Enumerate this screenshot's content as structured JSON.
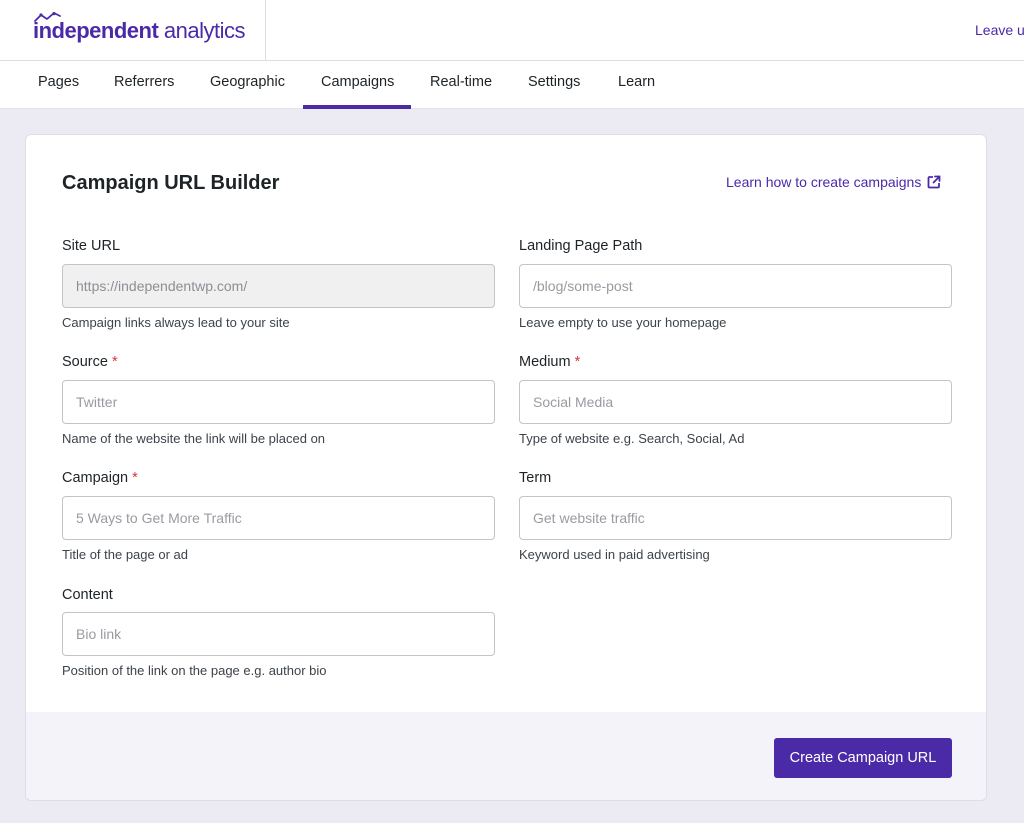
{
  "brand": {
    "bold": "independent",
    "light": " analytics",
    "color": "#4b2aa8"
  },
  "header": {
    "leave_link": "Leave u"
  },
  "nav": {
    "items": [
      {
        "label": "Pages"
      },
      {
        "label": "Referrers"
      },
      {
        "label": "Geographic"
      },
      {
        "label": "Campaigns",
        "active": true
      },
      {
        "label": "Real-time"
      },
      {
        "label": "Settings"
      },
      {
        "label": "Learn"
      }
    ]
  },
  "card": {
    "title": "Campaign URL Builder",
    "learn_link": "Learn how to create campaigns",
    "learn_icon": "external-link-icon"
  },
  "form": {
    "site_url": {
      "label": "Site URL",
      "value": "https://independentwp.com/",
      "help": "Campaign links always lead to your site"
    },
    "landing_path": {
      "label": "Landing Page Path",
      "placeholder": "/blog/some-post",
      "help": "Leave empty to use your homepage"
    },
    "source": {
      "label": "Source",
      "required": "*",
      "placeholder": "Twitter",
      "help": "Name of the website the link will be placed on"
    },
    "medium": {
      "label": "Medium",
      "required": "*",
      "placeholder": "Social Media",
      "help": "Type of website e.g. Search, Social, Ad"
    },
    "campaign": {
      "label": "Campaign",
      "required": "*",
      "placeholder": "5 Ways to Get More Traffic",
      "help": "Title of the page or ad"
    },
    "term": {
      "label": "Term",
      "placeholder": "Get website traffic",
      "help": "Keyword used in paid advertising"
    },
    "content": {
      "label": "Content",
      "placeholder": "Bio link",
      "help": "Position of the link on the page e.g. author bio"
    }
  },
  "footer": {
    "create_button": "Create Campaign URL"
  }
}
